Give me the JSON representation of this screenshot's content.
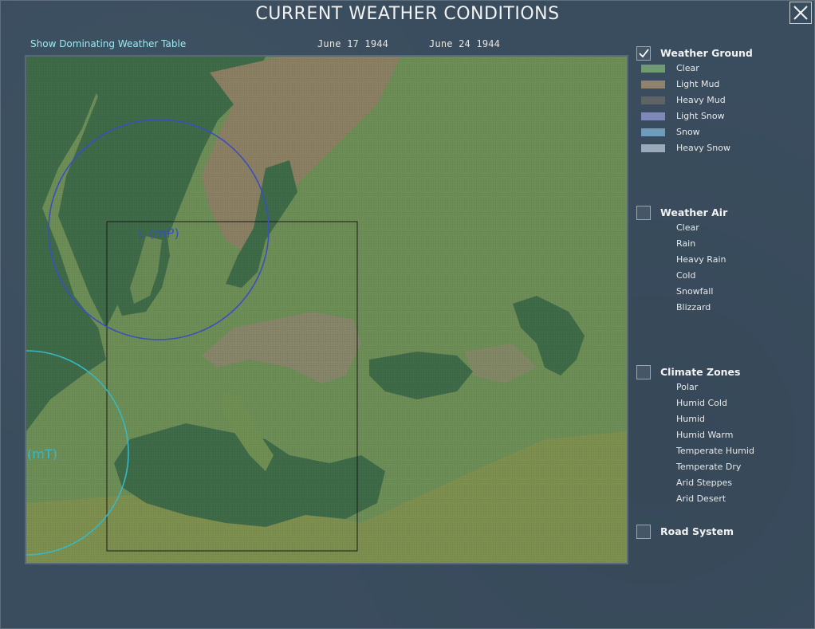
{
  "window": {
    "title": "CURRENT WEATHER CONDITIONS"
  },
  "toolbar": {
    "toggle_table_label": "Show Dominating Weather Table",
    "date_current": "June  17  1944",
    "date_next": "June  24  1944"
  },
  "map": {
    "systems": [
      {
        "label": "L (mP)",
        "color": "#3a4fbf"
      },
      {
        "label": "(mT)",
        "color": "#35b8c8"
      }
    ]
  },
  "legend": {
    "weather_ground": {
      "title": "Weather Ground",
      "checked": true,
      "items": [
        {
          "label": "Clear",
          "color": "#6f9a72"
        },
        {
          "label": "Light Mud",
          "color": "#8f8370"
        },
        {
          "label": "Heavy Mud",
          "color": "#5e6366"
        },
        {
          "label": "Light Snow",
          "color": "#8088b8"
        },
        {
          "label": "Snow",
          "color": "#6f9cbc"
        },
        {
          "label": "Heavy Snow",
          "color": "#9aaabb"
        }
      ]
    },
    "weather_air": {
      "title": "Weather Air",
      "checked": false,
      "items": [
        {
          "label": "Clear"
        },
        {
          "label": "Rain"
        },
        {
          "label": "Heavy Rain"
        },
        {
          "label": "Cold"
        },
        {
          "label": "Snowfall"
        },
        {
          "label": "Blizzard"
        }
      ]
    },
    "climate_zones": {
      "title": "Climate Zones",
      "checked": false,
      "items": [
        {
          "label": "Polar"
        },
        {
          "label": "Humid Cold"
        },
        {
          "label": "Humid"
        },
        {
          "label": "Humid Warm"
        },
        {
          "label": "Temperate Humid"
        },
        {
          "label": "Temperate Dry"
        },
        {
          "label": "Arid Steppes"
        },
        {
          "label": "Arid Desert"
        }
      ]
    },
    "road_system": {
      "title": "Road System",
      "checked": false
    }
  }
}
